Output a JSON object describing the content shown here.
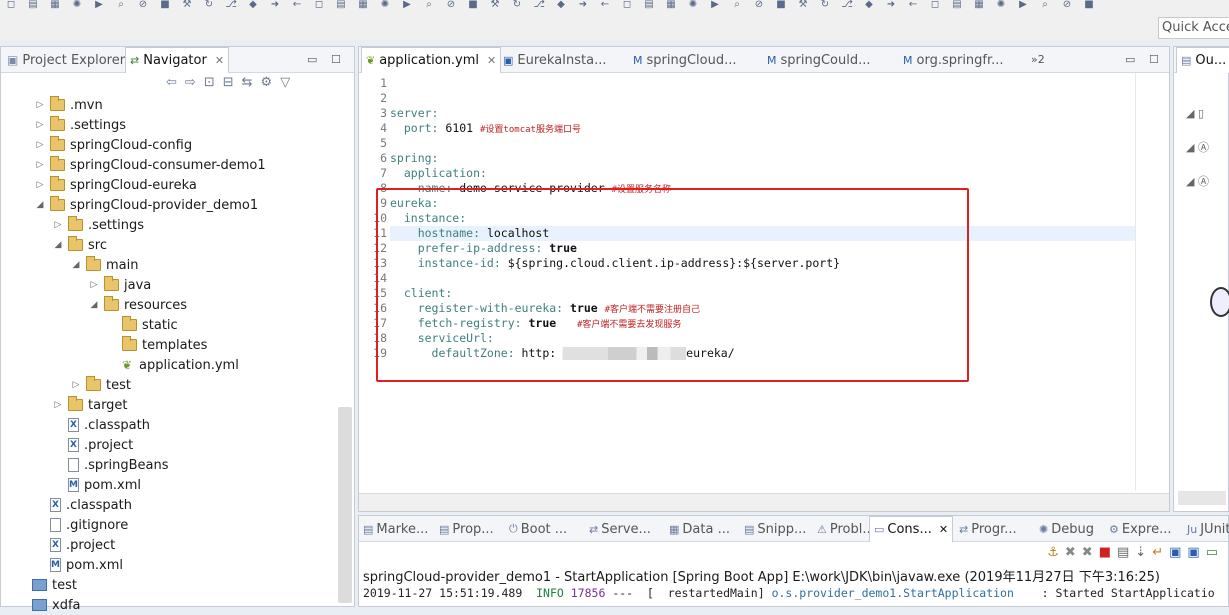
{
  "toolbar": {
    "icons": [
      "new-icon",
      "save-icon",
      "print-icon",
      "debug-icon",
      "run-icon",
      "search-icon",
      "skip-icon",
      "terminate-icon",
      "build-icon",
      "refresh-icon",
      "git-icon",
      "open-type-icon",
      "forward-icon",
      "back-icon"
    ],
    "quick_access": "Quick Access"
  },
  "navigator": {
    "tabs": [
      {
        "label": "Project Explorer",
        "icon": "project-explorer-icon"
      },
      {
        "label": "Navigator",
        "icon": "navigator-icon"
      }
    ],
    "items": [
      {
        "label": ".mvn",
        "type": "folder",
        "expanded": false
      },
      {
        "label": ".settings",
        "type": "folder",
        "expanded": false
      },
      {
        "label": "springCloud-config",
        "type": "folder",
        "expanded": false
      },
      {
        "label": "springCloud-consumer-demo1",
        "type": "folder",
        "expanded": false
      },
      {
        "label": "springCloud-eureka",
        "type": "folder",
        "expanded": false
      },
      {
        "label": "springCloud-provider_demo1",
        "type": "folder",
        "expanded": true
      },
      {
        "label": ".settings",
        "type": "folder",
        "expanded": false
      },
      {
        "label": "src",
        "type": "folder",
        "expanded": true
      },
      {
        "label": "main",
        "type": "folder",
        "expanded": true
      },
      {
        "label": "java",
        "type": "folder",
        "expanded": false
      },
      {
        "label": "resources",
        "type": "folder",
        "expanded": true
      },
      {
        "label": "static",
        "type": "folder",
        "expanded": null
      },
      {
        "label": "templates",
        "type": "folder",
        "expanded": null
      },
      {
        "label": "application.yml",
        "type": "yml",
        "expanded": null
      },
      {
        "label": "test",
        "type": "folder",
        "expanded": false
      },
      {
        "label": "target",
        "type": "folder",
        "expanded": false
      },
      {
        "label": ".classpath",
        "type": "xml",
        "expanded": null
      },
      {
        "label": ".project",
        "type": "xml",
        "expanded": null
      },
      {
        "label": ".springBeans",
        "type": "text",
        "expanded": null
      },
      {
        "label": "pom.xml",
        "type": "maven",
        "expanded": null
      },
      {
        "label": ".classpath",
        "type": "xml",
        "expanded": null
      },
      {
        "label": ".gitignore",
        "type": "text",
        "expanded": null
      },
      {
        "label": ".project",
        "type": "xml",
        "expanded": null
      },
      {
        "label": "pom.xml",
        "type": "maven",
        "expanded": null
      },
      {
        "label": "test",
        "type": "project",
        "expanded": null
      },
      {
        "label": "xdfa",
        "type": "project",
        "expanded": null
      }
    ]
  },
  "editor": {
    "tabs": [
      {
        "label": "application.yml",
        "icon": "yml-file-icon"
      },
      {
        "label": "EurekaInsta...",
        "icon": "class-file-icon"
      },
      {
        "label": "springCloud...",
        "icon": "maven-file-icon"
      },
      {
        "label": "springCould...",
        "icon": "maven-file-icon"
      },
      {
        "label": "org.springfr...",
        "icon": "maven-file-icon"
      }
    ],
    "overflow_label": "»2",
    "lines": [
      {
        "n": "1",
        "parts": []
      },
      {
        "n": "2",
        "parts": []
      },
      {
        "n": "3",
        "parts": [
          {
            "t": "k",
            "s": "server:"
          }
        ]
      },
      {
        "n": "4",
        "parts": [
          {
            "t": "k",
            "s": "  port:"
          },
          {
            "t": "v",
            "s": " 6101 "
          },
          {
            "t": "c",
            "s": "#设置tomcat服务端口号"
          }
        ]
      },
      {
        "n": "5",
        "parts": []
      },
      {
        "n": "6",
        "parts": [
          {
            "t": "k",
            "s": "spring:"
          }
        ]
      },
      {
        "n": "7",
        "parts": [
          {
            "t": "k",
            "s": "  application:"
          }
        ]
      },
      {
        "n": "8",
        "parts": [
          {
            "t": "k",
            "s": "    name:"
          },
          {
            "t": "v",
            "s": " demo-service-provider "
          },
          {
            "t": "c",
            "s": "#设置服务名称"
          }
        ]
      },
      {
        "n": "9",
        "parts": [
          {
            "t": "k",
            "s": "eureka:"
          }
        ]
      },
      {
        "n": "10",
        "parts": [
          {
            "t": "k",
            "s": "  instance:"
          }
        ]
      },
      {
        "n": "11",
        "parts": [
          {
            "t": "k",
            "s": "    hostname:"
          },
          {
            "t": "v",
            "s": " localhost"
          }
        ]
      },
      {
        "n": "12",
        "parts": [
          {
            "t": "k",
            "s": "    prefer-ip-address:"
          },
          {
            "t": "b",
            "s": " true"
          }
        ]
      },
      {
        "n": "13",
        "parts": [
          {
            "t": "k",
            "s": "    instance-id:"
          },
          {
            "t": "v",
            "s": " ${spring.cloud.client.ip-address}:${server.port}"
          }
        ]
      },
      {
        "n": "14",
        "parts": []
      },
      {
        "n": "15",
        "parts": [
          {
            "t": "k",
            "s": "  client:"
          }
        ]
      },
      {
        "n": "16",
        "parts": [
          {
            "t": "k",
            "s": "    register-with-eureka:"
          },
          {
            "t": "b",
            "s": " true "
          },
          {
            "t": "c",
            "s": "#客户端不需要注册自己"
          }
        ]
      },
      {
        "n": "17",
        "parts": [
          {
            "t": "k",
            "s": "    fetch-registry:"
          },
          {
            "t": "b",
            "s": " true   "
          },
          {
            "t": "c",
            "s": "#客户端不需要去发现服务"
          }
        ]
      },
      {
        "n": "18",
        "parts": [
          {
            "t": "k",
            "s": "    serviceUrl:"
          }
        ]
      },
      {
        "n": "19",
        "parts": [
          {
            "t": "k",
            "s": "      defaultZone:"
          },
          {
            "t": "v",
            "s": " http:"
          },
          {
            "t": "blur",
            "s": ""
          },
          {
            "t": "v",
            "s": "eureka/"
          }
        ]
      }
    ],
    "current_line": "11"
  },
  "outline": {
    "tab_label": "Ou..."
  },
  "console": {
    "tabs": [
      {
        "label": "Marke...",
        "icon": "markers-icon"
      },
      {
        "label": "Prop...",
        "icon": "properties-icon"
      },
      {
        "label": "Boot ...",
        "icon": "boot-dashboard-icon"
      },
      {
        "label": "Serve...",
        "icon": "servers-icon"
      },
      {
        "label": "Data ...",
        "icon": "data-source-icon"
      },
      {
        "label": "Snipp...",
        "icon": "snippets-icon"
      },
      {
        "label": "Probl...",
        "icon": "problems-icon"
      },
      {
        "label": "Cons...",
        "icon": "console-icon"
      },
      {
        "label": "Progr...",
        "icon": "progress-icon"
      },
      {
        "label": "Debug",
        "icon": "debug-icon"
      },
      {
        "label": "Expre...",
        "icon": "expressions-icon"
      },
      {
        "label": "JUnit",
        "icon": "junit-icon"
      }
    ],
    "launch_info": "springCloud-provider_demo1 - StartApplication [Spring Boot App] E:\\work\\JDK\\bin\\javaw.exe (2019年11月27日 下午3:16:25)",
    "log": {
      "time": "2019-11-27 15:51:19.489",
      "level": "INFO",
      "pid": "17856",
      "thread": "---  [  restartedMain]",
      "logger": "o.s.provider_demo1.StartApplication",
      "message": ": Started StartApplicatio"
    }
  }
}
